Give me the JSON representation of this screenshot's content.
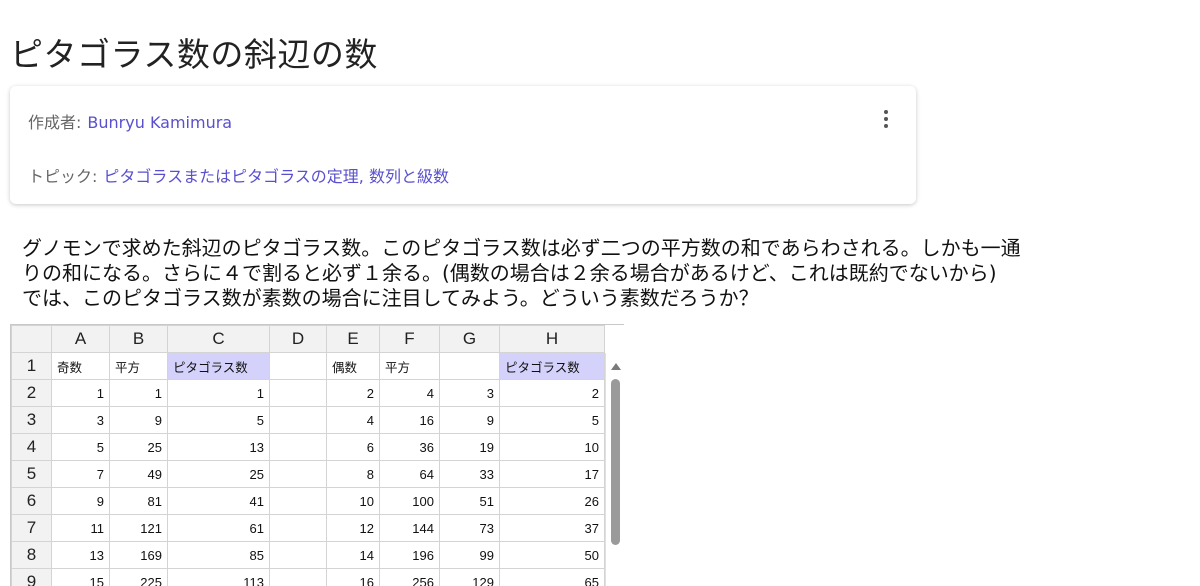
{
  "page": {
    "title": "ピタゴラス数の斜辺の数"
  },
  "info": {
    "author_label": "作成者:",
    "author": "Bunryu Kamimura",
    "topic_label": "トピック:",
    "topics": "ピタゴラスまたはピタゴラスの定理, 数列と級数",
    "more_icon": "more-vertical-icon"
  },
  "description": [
    "グノモンで求めた斜辺のピタゴラス数。このピタゴラス数は必ず二つの平方数の和であらわされる。しかも一通",
    "りの和になる。さらに４で割ると必ず１余る。(偶数の場合は２余る場合があるけど、これは既約でないから)",
    "では、このピタゴラス数が素数の場合に注目してみよう。どういう素数だろうか？"
  ],
  "spreadsheet": {
    "columns": [
      "A",
      "B",
      "C",
      "D",
      "E",
      "F",
      "G",
      "H"
    ],
    "header_row": [
      "奇数",
      "平方",
      "ピタゴラス数",
      "",
      "偶数",
      "平方",
      "",
      "ピタゴラス数"
    ],
    "highlight_color": "#d4d2fb",
    "highlighted_columns": [
      "C",
      "H"
    ],
    "rows": [
      {
        "n": "1",
        "cells": [
          "奇数",
          "平方",
          "ピタゴラス数",
          "",
          "偶数",
          "平方",
          "",
          "ピタゴラス数"
        ]
      },
      {
        "n": "2",
        "cells": [
          "1",
          "1",
          "1",
          "",
          "2",
          "4",
          "3",
          "2"
        ]
      },
      {
        "n": "3",
        "cells": [
          "3",
          "9",
          "5",
          "",
          "4",
          "16",
          "9",
          "5"
        ]
      },
      {
        "n": "4",
        "cells": [
          "5",
          "25",
          "13",
          "",
          "6",
          "36",
          "19",
          "10"
        ]
      },
      {
        "n": "5",
        "cells": [
          "7",
          "49",
          "25",
          "",
          "8",
          "64",
          "33",
          "17"
        ]
      },
      {
        "n": "6",
        "cells": [
          "9",
          "81",
          "41",
          "",
          "10",
          "100",
          "51",
          "26"
        ]
      },
      {
        "n": "7",
        "cells": [
          "11",
          "121",
          "61",
          "",
          "12",
          "144",
          "73",
          "37"
        ]
      },
      {
        "n": "8",
        "cells": [
          "13",
          "169",
          "85",
          "",
          "14",
          "196",
          "99",
          "50"
        ]
      },
      {
        "n": "9",
        "cells": [
          "15",
          "225",
          "113",
          "",
          "16",
          "256",
          "129",
          "65"
        ]
      }
    ]
  }
}
